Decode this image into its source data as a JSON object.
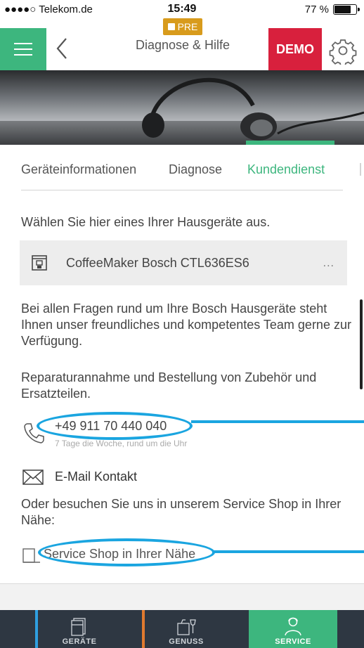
{
  "status_bar": {
    "carrier": "●●●●○ Telekom.de",
    "time": "15:49",
    "battery": "77 %",
    "battery_level": 0.77
  },
  "header": {
    "title": "Diagnose & Hilfe",
    "pre_badge": "PRE",
    "demo_label": "DEMO",
    "icons": [
      "menu-icon",
      "back-chevron-icon",
      "gear-icon"
    ]
  },
  "tabs": [
    {
      "label": "Geräteinformationen",
      "active": false
    },
    {
      "label": "Diagnose",
      "active": false
    },
    {
      "label": "Kundendienst",
      "active": true
    }
  ],
  "content": {
    "intro": "Wählen Sie hier eines Ihrer Hausgeräte aus.",
    "device": {
      "name": "CoffeeMaker Bosch CTL636ES6",
      "more": "...",
      "icon": "coffee-machine-icon"
    },
    "para1": "Bei allen Fragen rund um Ihre Bosch Hausgeräte steht Ihnen unser freundliches und kompetentes Team gerne zur Verfügung.",
    "para2": "Reparaturannahme und Bestellung von Zubehör und Ersatzteilen.",
    "phone": {
      "number": "+49 911 70 440 040",
      "hours": "7 Tage die Woche, rund um die Uhr",
      "icon": "phone-icon"
    },
    "email": {
      "label": "E-Mail Kontakt",
      "icon": "mail-icon"
    },
    "para3": "Oder besuchen Sie uns in unserem Service Shop in Ihrer Nähe:",
    "shop": {
      "label": "Service Shop in Ihrer Nähe",
      "icon": "shop-icon"
    }
  },
  "bottom_nav": [
    {
      "label": "GERÄTE",
      "icon": "devices-icon",
      "accent": "#2f9fe0",
      "active": false
    },
    {
      "label": "GENUSS",
      "icon": "kitchen-icon",
      "accent": "#e07a2f",
      "active": false
    },
    {
      "label": "SERVICE",
      "icon": "service-person-icon",
      "accent": "#3db67e",
      "active": true
    }
  ],
  "colors": {
    "accent_green": "#3db67e",
    "demo_red": "#d8203d",
    "pre_orange": "#d89b1c",
    "nav_bg": "#2e3742",
    "annotation_blue": "#1aa5e0"
  }
}
